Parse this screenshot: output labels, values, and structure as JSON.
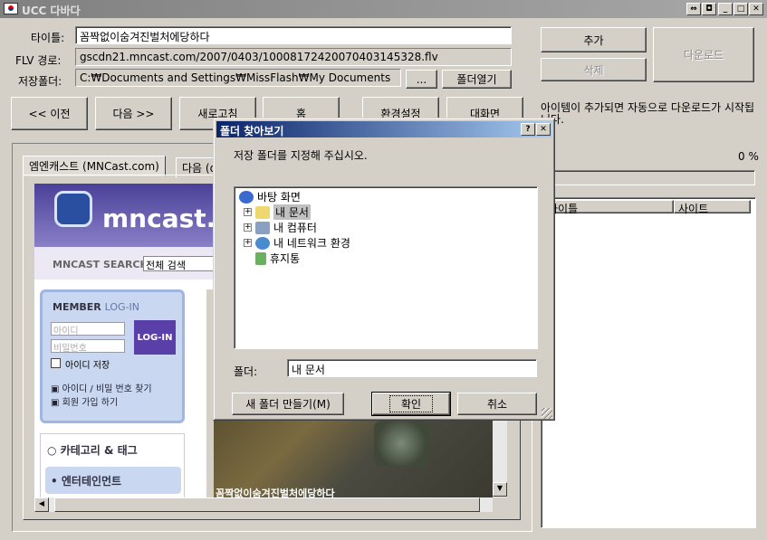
{
  "window": {
    "title": "UCC 다바다"
  },
  "form": {
    "title_label": "타이틀:",
    "title_value": "꼼짝없이숨겨진벌처에당하다",
    "flv_label": "FLV 경로:",
    "flv_value": "gscdn21.mncast.com/2007/0403/10008172420070403145328.flv",
    "folder_label": "저장폴더:",
    "folder_value": "C:₩Documents and Settings₩MissFlash₩My Documents",
    "browse_label": "...",
    "open_folder_label": "폴더열기"
  },
  "actions": {
    "add": "추가",
    "delete": "삭제",
    "download": "다운로드"
  },
  "nav": {
    "prev": "<< 이전",
    "next": "다음 >>",
    "refresh": "새로고침",
    "home": "홈",
    "settings": "환경설정",
    "maximize": "대화면"
  },
  "info_text": "아이템이 추가되면 자동으로 다운로드가 시작됩니다.",
  "progress": {
    "percent_text": "0 %",
    "value": 0
  },
  "list": {
    "columns": [
      "타이틀",
      "사이트"
    ]
  },
  "tabs": [
    {
      "label": "엠엔캐스트 (MNCast.com)"
    },
    {
      "label": "다음 (d"
    }
  ],
  "browser": {
    "logo": "mncast.c",
    "search_label": "MNCAST SEARCH",
    "search_select": "전체 검색",
    "member_title_1": "MEMBER",
    "member_title_2": "LOG-IN",
    "id_placeholder": "아이디",
    "pw_placeholder": "비밀번호",
    "login_btn": "LOG-IN",
    "save_id": "아이디 저장",
    "find_link": "아이디 / 비밀 번호 찾기",
    "join_link": "회원 가입 하기",
    "category": "카테고리 & 태그",
    "entertainment": "엔터테인먼트",
    "video_caption": "꼼짝없이숨겨진벌처에당하다"
  },
  "dialog": {
    "title": "폴더 찾아보기",
    "help": "?",
    "close": "✕",
    "prompt": "저장 폴더를 지정해 주십시오.",
    "tree": [
      {
        "label": "바탕 화면"
      },
      {
        "label": "내 문서"
      },
      {
        "label": "내 컴퓨터"
      },
      {
        "label": "내 네트워크 환경"
      },
      {
        "label": "휴지통"
      }
    ],
    "folder_label": "폴더:",
    "folder_value": "내 문서",
    "new_folder": "새 폴더 만들기(M)",
    "ok": "확인",
    "cancel": "취소"
  },
  "colors": {
    "dialog_title": "#0a246a",
    "selection": "#c0c0c0",
    "mncast_purple": "#5a4fa0",
    "login_purple": "#5a3fa8"
  }
}
